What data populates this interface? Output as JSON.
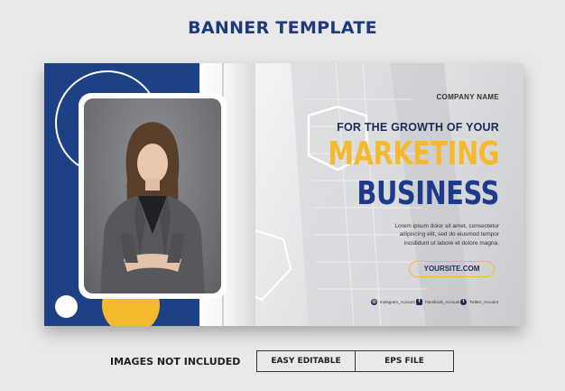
{
  "header": {
    "title": "BANNER TEMPLATE"
  },
  "banner": {
    "company_name": "COMPANY NAME",
    "tagline": "FOR THE GROWTH OF YOUR",
    "headline_line1": "MARKETING",
    "headline_line2": "BUSINESS",
    "body_lines": [
      "Lorem ipsum dolor sit amet, consectetur",
      "adipiscing elit, sed do eiusmod tempor",
      "incididunt ut labore et dolore magna."
    ],
    "website": "YOURSITE.COM",
    "social": [
      {
        "icon": "instagram-icon",
        "label": "Instagram_Account"
      },
      {
        "icon": "facebook-icon",
        "label": "Facebook_Account"
      },
      {
        "icon": "twitter-icon",
        "label": "Twitter_Account"
      }
    ]
  },
  "footer": {
    "notice": "IMAGES NOT INCLUDED",
    "features": [
      "EASY EDITABLE",
      "EPS FILE"
    ]
  },
  "colors": {
    "navy": "#1e4185",
    "yellow": "#f4b92c",
    "headline_blue": "#1e3a8a",
    "background": "#e9e9ea"
  }
}
